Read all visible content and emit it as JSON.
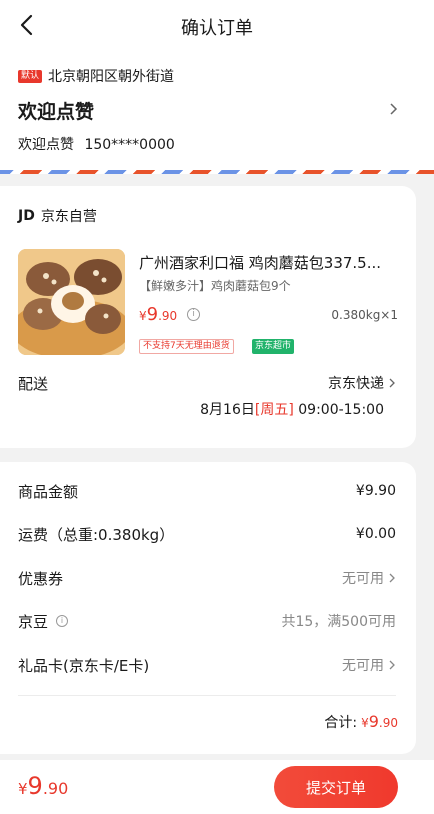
{
  "header": {
    "title": "确认订单"
  },
  "address": {
    "default_tag": "默认",
    "region": "北京朝阳区朝外街道",
    "name": "欢迎点赞",
    "contact_name": "欢迎点赞",
    "phone": "150****0000"
  },
  "shop": {
    "logo": "JD",
    "name": "京东自营"
  },
  "product": {
    "title": "广州酒家利口福 鸡肉蘑菇包337.5...",
    "subtitle": "【鲜嫩多汁】鸡肉蘑菇包9个",
    "price_symbol": "¥",
    "price_int": "9",
    "price_dec": ".90",
    "info_glyph": "i",
    "qty": "0.380kg×1",
    "tags": [
      "不支持7天无理由退货",
      "京东超市"
    ]
  },
  "shipping": {
    "label": "配送",
    "carrier": "京东快递",
    "date": "8月16日",
    "weekday": "[周五]",
    "time": "09:00-15:00"
  },
  "summary": {
    "rows": [
      {
        "label": "商品金额",
        "value": "¥9.90"
      },
      {
        "label": "运费（总重:0.380kg）",
        "value": "¥0.00"
      },
      {
        "label": "优惠券",
        "value": "无可用"
      },
      {
        "label": "京豆",
        "value": "共15，满500可用"
      },
      {
        "label": "礼品卡(京东卡/E卡)",
        "value": "无可用"
      }
    ],
    "total_label": "合计:",
    "total_symbol": "¥",
    "total_int": "9",
    "total_dec": ".90"
  },
  "bottom": {
    "price_symbol": "¥",
    "price_int": "9",
    "price_dec": ".90",
    "submit_label": "提交订单"
  },
  "colors": {
    "accent": "#e8382c",
    "green_tag": "#21b36b",
    "stripe_blue": "#6b93e6",
    "stripe_red": "#e8532b"
  }
}
